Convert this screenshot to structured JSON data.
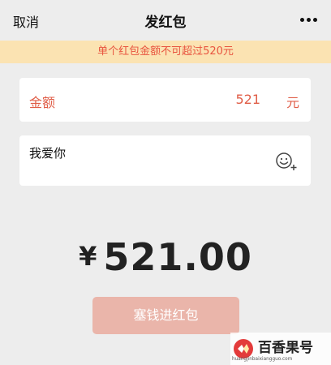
{
  "navbar": {
    "cancel_label": "取消",
    "title": "发红包",
    "more_icon": "more-dots-icon"
  },
  "banner": {
    "text": "单个红包金额不可超过520元"
  },
  "amount": {
    "label": "金额",
    "value": "521",
    "unit": "元"
  },
  "message": {
    "text": "我爱你",
    "emoji_icon": "emoji-add-icon"
  },
  "total": {
    "currency": "¥",
    "amount": "521.00"
  },
  "submit": {
    "label": "塞钱进红包"
  },
  "watermark": {
    "title": "百香果号",
    "url": "huangjinbaixiangguo.com"
  },
  "colors": {
    "background": "#ededed",
    "banner_bg": "#fbe3b2",
    "warning_text": "#e8543f",
    "button_disabled": "#eab5aa"
  }
}
